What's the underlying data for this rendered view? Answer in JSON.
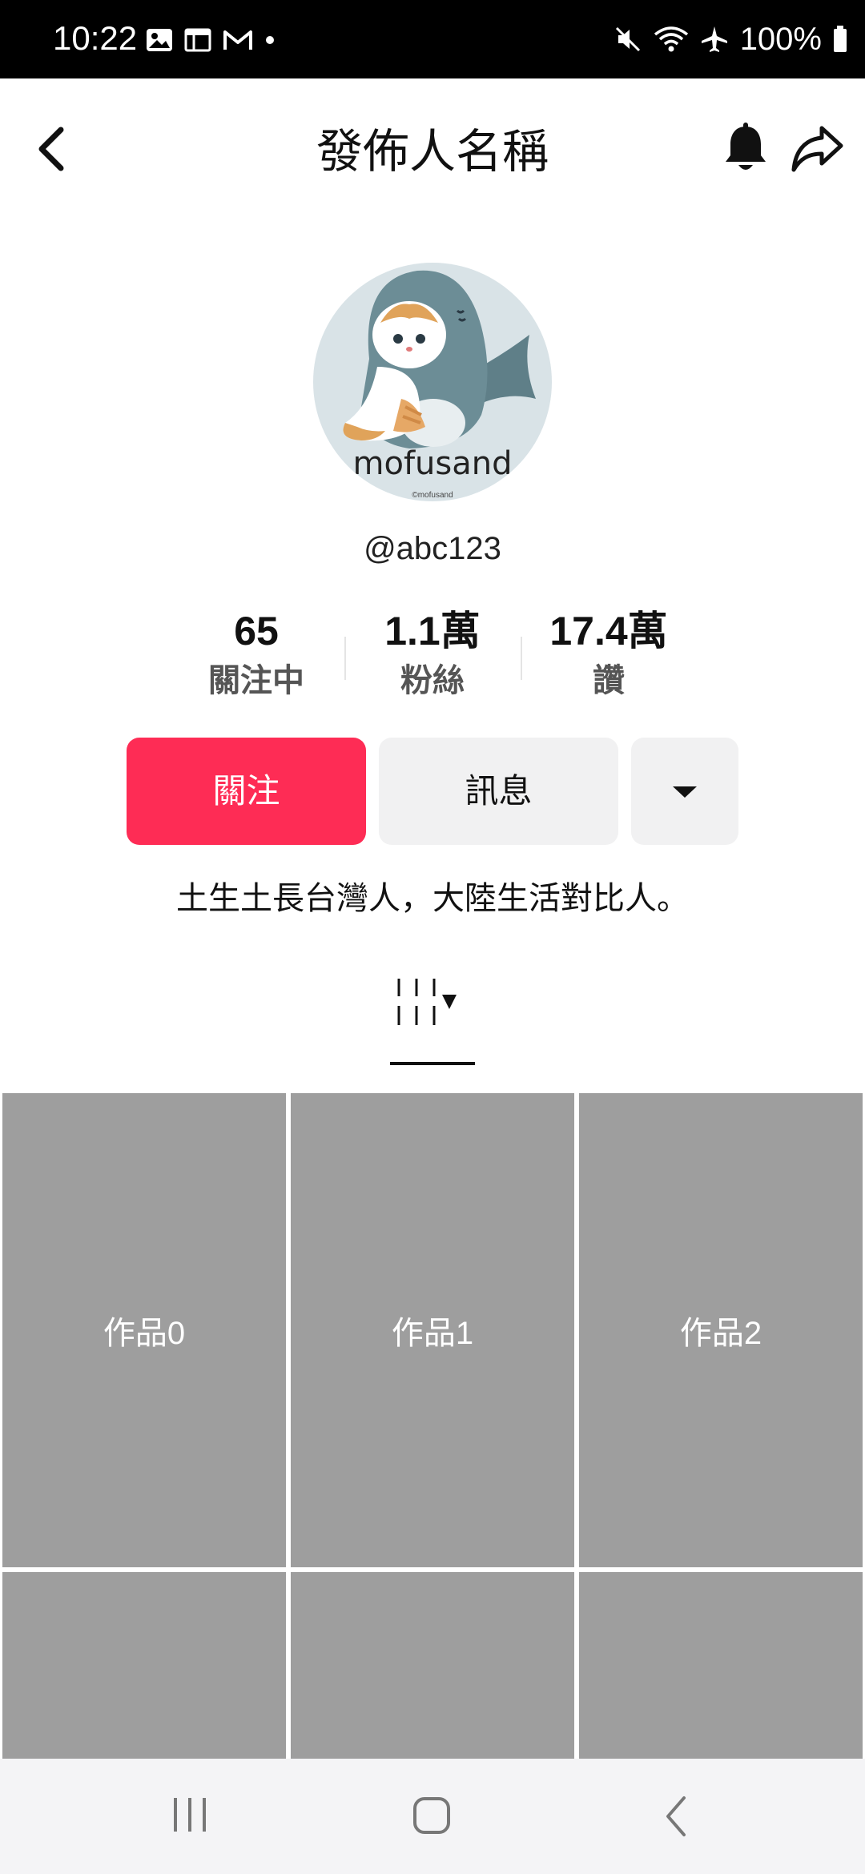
{
  "status_bar": {
    "time": "10:22",
    "battery": "100%"
  },
  "header": {
    "title": "發佈人名稱"
  },
  "profile": {
    "avatar_brand": "mofusand",
    "avatar_small": "©mofusand",
    "handle": "@abc123",
    "bio": "土生土長台灣人，大陸生活對比人。"
  },
  "stats": [
    {
      "value": "65",
      "label": "關注中"
    },
    {
      "value": "1.1萬",
      "label": "粉絲"
    },
    {
      "value": "17.4萬",
      "label": "讚"
    }
  ],
  "actions": {
    "follow": "關注",
    "message": "訊息"
  },
  "colors": {
    "accent": "#fe2c55",
    "secondary_button": "#f1f1f2",
    "placeholder": "#9e9e9e"
  },
  "posts": [
    "作品0",
    "作品1",
    "作品2",
    "",
    "",
    ""
  ]
}
